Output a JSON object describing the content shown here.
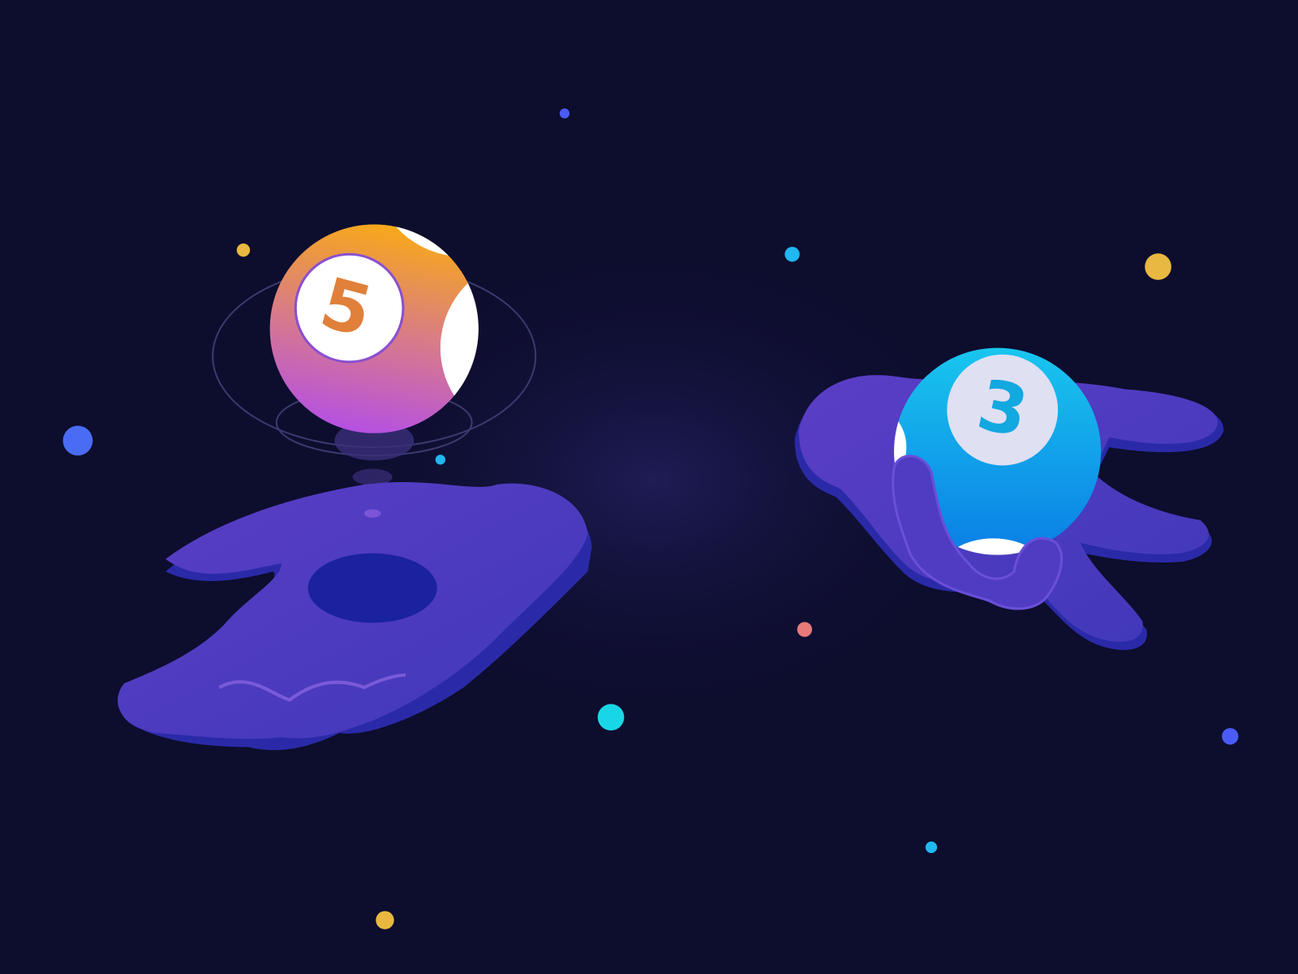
{
  "scene": {
    "background_color": "#0d0d2e",
    "hand_color": "#5a3fc8",
    "hand_shadow_color": "#2a2aa8",
    "left_ball": {
      "number": "5",
      "colors": [
        "#f7a81b",
        "#b34ee8"
      ]
    },
    "right_ball": {
      "number": "3",
      "colors": [
        "#19c6ee",
        "#0a7ee6"
      ]
    },
    "stars": [
      {
        "color": "#4a5cf5"
      },
      {
        "color": "#e8b840"
      },
      {
        "color": "#1fb8f0"
      },
      {
        "color": "#e8b840"
      },
      {
        "color": "#4a6cf5"
      },
      {
        "color": "#1fb8f0"
      },
      {
        "color": "#e87a7a"
      },
      {
        "color": "#19d6e6"
      },
      {
        "color": "#4a5cf5"
      },
      {
        "color": "#1fb8f0"
      },
      {
        "color": "#e8b840"
      }
    ]
  }
}
